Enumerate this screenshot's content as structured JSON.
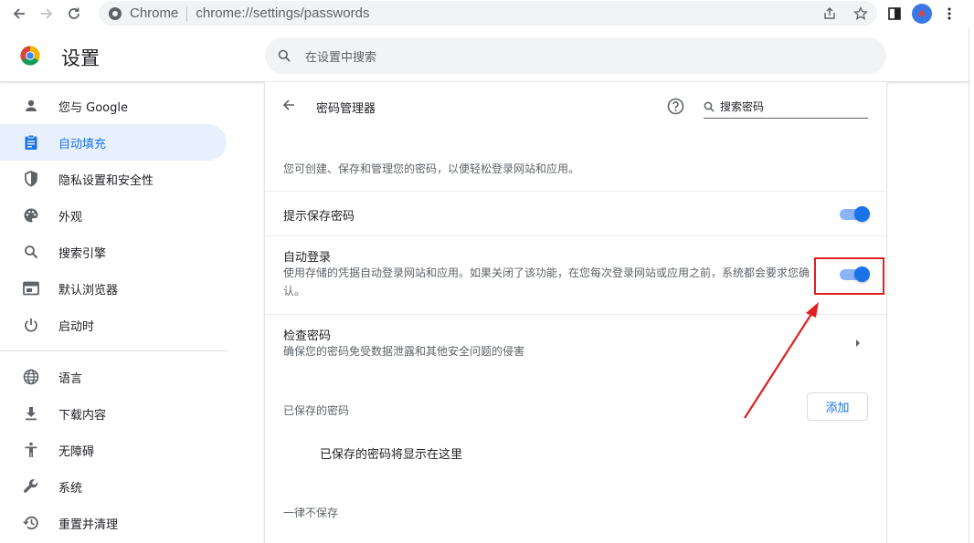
{
  "browser": {
    "site_name": "Chrome",
    "url": "chrome://settings/passwords"
  },
  "header": {
    "title": "设置",
    "search_placeholder": "在设置中搜索"
  },
  "sidebar": {
    "items": [
      {
        "label": "您与 Google",
        "icon": "person-icon"
      },
      {
        "label": "自动填充",
        "icon": "clipboard-icon",
        "active": true
      },
      {
        "label": "隐私设置和安全性",
        "icon": "shield-icon"
      },
      {
        "label": "外观",
        "icon": "palette-icon"
      },
      {
        "label": "搜索引擎",
        "icon": "search-icon"
      },
      {
        "label": "默认浏览器",
        "icon": "browser-icon"
      },
      {
        "label": "启动时",
        "icon": "power-icon"
      },
      {
        "label": "语言",
        "icon": "globe-icon"
      },
      {
        "label": "下载内容",
        "icon": "download-icon"
      },
      {
        "label": "无障碍",
        "icon": "accessibility-icon"
      },
      {
        "label": "系统",
        "icon": "wrench-icon"
      },
      {
        "label": "重置并清理",
        "icon": "history-icon"
      }
    ]
  },
  "passwords": {
    "title": "密码管理器",
    "search_placeholder": "搜索密码",
    "description": "您可创建、保存和管理您的密码，以便轻松登录网站和应用。",
    "offer_save": {
      "label": "提示保存密码",
      "enabled": true
    },
    "auto_signin": {
      "label": "自动登录",
      "description": "使用存储的凭据自动登录网站和应用。如果关闭了该功能，在您每次登录网站或应用之前，系统都会要求您确认。",
      "enabled": true
    },
    "check": {
      "label": "检查密码",
      "description": "确保您的密码免受数据泄露和其他安全问题的侵害"
    },
    "saved_section": "已保存的密码",
    "add_label": "添加",
    "empty_message": "已保存的密码将显示在这里",
    "never_saved_section": "一律不保存"
  },
  "colors": {
    "accent": "#1a73e8",
    "annotation": "#e02020"
  }
}
